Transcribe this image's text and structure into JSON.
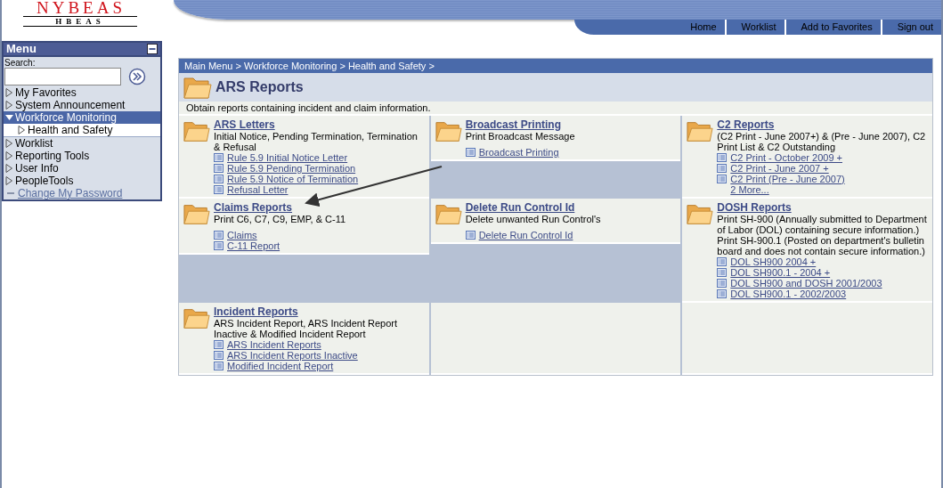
{
  "logo": {
    "title": "NYBEAS",
    "subtitle": "HBEAS"
  },
  "header_links": [
    "Home",
    "Worklist",
    "Add to Favorites",
    "Sign out"
  ],
  "menu": {
    "title": "Menu",
    "search_label": "Search:",
    "items": [
      {
        "label": "My Favorites",
        "kind": "folder",
        "expanded": false,
        "selected": false
      },
      {
        "label": "System Announcement",
        "kind": "folder",
        "expanded": false,
        "selected": false
      },
      {
        "label": "Workforce Monitoring",
        "kind": "folder",
        "expanded": true,
        "selected": true,
        "children": [
          {
            "label": "Health and Safety",
            "kind": "folder",
            "expanded": false,
            "selected": false
          }
        ]
      },
      {
        "label": "Worklist",
        "kind": "folder",
        "expanded": false,
        "selected": false
      },
      {
        "label": "Reporting Tools",
        "kind": "folder",
        "expanded": false,
        "selected": false
      },
      {
        "label": "User Info",
        "kind": "folder",
        "expanded": false,
        "selected": false
      },
      {
        "label": "PeopleTools",
        "kind": "folder",
        "expanded": false,
        "selected": false
      },
      {
        "label": "Change My Password",
        "kind": "link"
      }
    ]
  },
  "breadcrumb": {
    "separator": ">",
    "items": [
      "Main Menu",
      "Workforce Monitoring",
      "Health and Safety"
    ]
  },
  "page_title": "ARS Reports",
  "description": "Obtain reports containing incident and claim information.",
  "rows": [
    [
      {
        "kind": "folder",
        "title": "ARS Letters",
        "description": "Initial Notice, Pending Termination, Termination & Refusal",
        "links": [
          "Rule 5.9 Initial Notice Letter",
          "Rule 5.9 Pending Termination",
          "Rule 5.9 Notice of Termination",
          "Refusal Letter"
        ]
      },
      {
        "kind": "folder",
        "title": "Broadcast Printing",
        "description": "Print Broadcast Message",
        "gap": true,
        "links": [
          "Broadcast Printing"
        ]
      },
      {
        "kind": "folder",
        "title": "C2 Reports",
        "description": "(C2 Print - June 2007+) & (Pre - June 2007), C2 Print List & C2 Outstanding",
        "links": [
          "C2 Print - October 2009 +",
          "C2 Print - June 2007 +",
          "C2 Print (Pre - June 2007)"
        ],
        "more": "2 More..."
      }
    ],
    [
      {
        "kind": "folder",
        "title": "Claims Reports",
        "description": "Print C6, C7, C9, EMP, & C-11",
        "gap": true,
        "links": [
          "Claims",
          "C-11 Report"
        ]
      },
      {
        "kind": "folder",
        "title": "Delete Run Control Id",
        "description": "Delete unwanted Run Control's",
        "gap": true,
        "links": [
          "Delete Run Control Id"
        ]
      },
      {
        "kind": "folder",
        "title": "DOSH Reports",
        "description": "Print SH-900 (Annually submitted to Department of Labor (DOL) containing secure information.) Print SH-900.1 (Posted on department's bulletin board and does not contain secure information.)",
        "links": [
          "DOL SH900 2004 +",
          "DOL SH900.1 - 2004 +",
          "DOL SH900 and DOSH 2001/2003",
          "DOL SH900.1 - 2002/2003"
        ]
      }
    ],
    [
      {
        "kind": "folder",
        "title": "Incident Reports",
        "description": "ARS Incident Report, ARS Incident Report Inactive & Modified Incident Report",
        "links": [
          "ARS Incident Reports",
          "ARS Incident Reports Inactive",
          "Modified Incident Report"
        ]
      },
      {
        "kind": "empty"
      },
      {
        "kind": "empty"
      }
    ]
  ]
}
